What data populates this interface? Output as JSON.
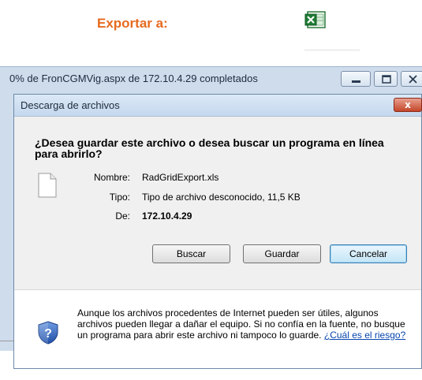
{
  "page": {
    "export_label": "Exportar a:",
    "export_icon": "excel-icon",
    "bg_text_left": "...",
    "bg_text_right": "..."
  },
  "progress_window": {
    "title": "0% de FronCGMVig.aspx de 172.10.4.29 completados",
    "buttons": [
      "minimize-icon",
      "maximize-icon",
      "close-icon"
    ]
  },
  "dialog": {
    "title": "Descarga de archivos",
    "close_label": "x",
    "question": "¿Desea guardar este archivo o desea buscar un programa en línea para abrirlo?",
    "fields": {
      "name_label": "Nombre:",
      "name_value": "RadGridExport.xls",
      "type_label": "Tipo:",
      "type_value": "Tipo de archivo desconocido, 11,5 KB",
      "from_label": "De:",
      "from_value": "172.10.4.29"
    },
    "buttons": {
      "search": "Buscar",
      "save": "Guardar",
      "cancel": "Cancelar"
    },
    "warning": {
      "text": "Aunque los archivos procedentes de Internet pueden ser útiles, algunos archivos pueden llegar a dañar el equipo. Si no confía en la fuente, no busque un programa para abrir este archivo ni tampoco lo guarde.",
      "link": "¿Cuál es el riesgo?"
    }
  },
  "colors": {
    "export_label": "#e66a1f",
    "dialog_bg": "#f0f0f0",
    "progress_bg": "#cfdcec",
    "link": "#0645ad"
  }
}
